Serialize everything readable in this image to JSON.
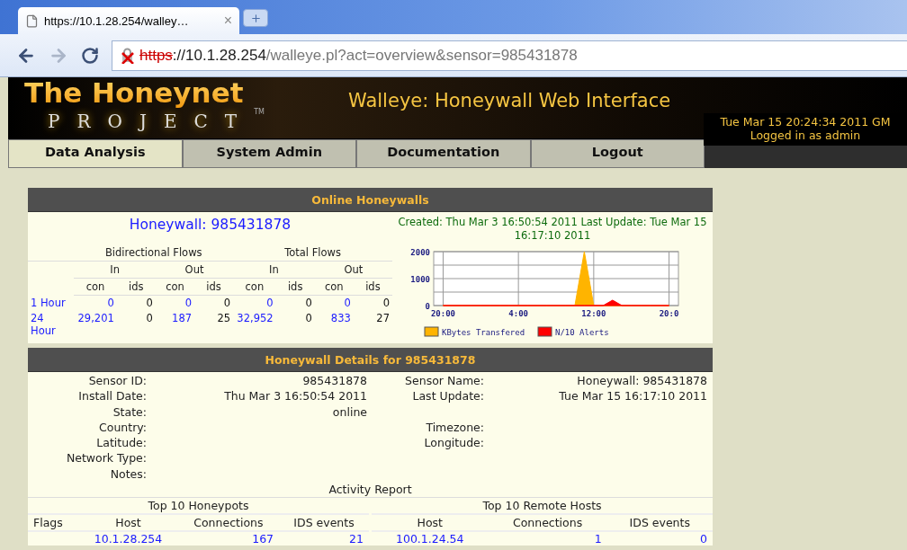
{
  "browser": {
    "tab": {
      "title": "https://10.1.28.254/walley…",
      "close": "×"
    },
    "address": {
      "scheme": "https",
      "host": "://10.1.28.254",
      "path": "/walleye.pl?act=overview&sensor=985431878"
    }
  },
  "header": {
    "logo_top": "The Honeynet",
    "logo_bottom": "PROJECT",
    "trademark": "TM",
    "title": "Walleye: Honeywall Web Interface",
    "datetime": "Tue Mar 15 20:24:34 2011 GM",
    "login": "Logged in as admin"
  },
  "nav": [
    {
      "label": "Data Analysis",
      "selected": true
    },
    {
      "label": "System Admin",
      "selected": false
    },
    {
      "label": "Documentation",
      "selected": false
    },
    {
      "label": "Logout",
      "selected": false
    }
  ],
  "online": {
    "title": "Online Honeywalls",
    "honeywall": "Honeywall: 985431878",
    "created": "Created: Thu Mar 3 16:50:54 2011 Last Update: Tue Mar 15 16:17:10 2011",
    "flows": {
      "groups": [
        "Bidirectional Flows",
        "Total Flows"
      ],
      "directions": [
        "In",
        "Out",
        "In",
        "Out"
      ],
      "columns": [
        "con",
        "ids",
        "con",
        "ids",
        "con",
        "ids",
        "con",
        "ids"
      ],
      "rows": [
        {
          "period": "1 Hour",
          "cells": [
            {
              "text": "0",
              "kind": "link"
            },
            {
              "text": "0",
              "kind": "plain"
            },
            {
              "text": "0",
              "kind": "link"
            },
            {
              "text": "0",
              "kind": "plain"
            },
            {
              "text": "0",
              "kind": "link"
            },
            {
              "text": "0",
              "kind": "plain"
            },
            {
              "text": "0",
              "kind": "link"
            },
            {
              "text": "0",
              "kind": "plain"
            }
          ]
        },
        {
          "period": "24 Hour",
          "cells": [
            {
              "text": "29,201",
              "kind": "link"
            },
            {
              "text": "0",
              "kind": "plain"
            },
            {
              "text": "187",
              "kind": "link"
            },
            {
              "text": "25",
              "kind": "plain"
            },
            {
              "text": "32,952",
              "kind": "link"
            },
            {
              "text": "0",
              "kind": "plain"
            },
            {
              "text": "833",
              "kind": "link"
            },
            {
              "text": "27",
              "kind": "plain"
            }
          ]
        }
      ]
    },
    "chart_data": {
      "type": "area",
      "categories": [
        "20:00",
        null,
        null,
        null,
        null,
        null,
        null,
        null,
        "4:00",
        null,
        null,
        null,
        null,
        null,
        null,
        null,
        "12:00",
        null,
        null,
        null,
        null,
        null,
        null,
        null,
        "20:0"
      ],
      "ylim": [
        0,
        2000
      ],
      "yticks": [
        0,
        1000,
        2000
      ],
      "grid": true,
      "legend": "bottom",
      "series": [
        {
          "name": "KBytes Transfered",
          "color": "#ffb400",
          "values": [
            0,
            0,
            0,
            0,
            0,
            0,
            0,
            0,
            0,
            0,
            0,
            0,
            0,
            0,
            0,
            2000,
            0,
            0,
            0,
            0,
            0,
            0,
            0,
            0,
            0
          ]
        },
        {
          "name": "N/10 Alerts",
          "color": "#ff0000",
          "values": [
            0,
            0,
            0,
            0,
            0,
            0,
            0,
            0,
            0,
            0,
            0,
            0,
            0,
            0,
            0,
            0,
            0,
            0,
            200,
            0,
            0,
            0,
            0,
            0,
            0
          ]
        }
      ]
    }
  },
  "details": {
    "title": "Honeywall Details for 985431878",
    "rows": [
      {
        "label": "Sensor ID:",
        "value": "985431878",
        "label_2": "Sensor Name:",
        "value_2": "Honeywall: 985431878"
      },
      {
        "label": "Install Date:",
        "value": "Thu Mar 3 16:50:54 2011",
        "label_2": "Last Update:",
        "value_2": "Tue Mar 15 16:17:10 2011"
      },
      {
        "label": "State:",
        "value": "online"
      },
      {
        "label": "Country:",
        "label_2": "Timezone:"
      },
      {
        "label": "Latitude:",
        "label_2": "Longitude:"
      },
      {
        "label": "Network Type:"
      },
      {
        "label": "Notes:"
      }
    ],
    "activity_title": "Activity Report",
    "honeypots": {
      "title": "Top 10 Honeypots",
      "columns": [
        "Flags",
        "Host",
        "Connections",
        "IDS events"
      ],
      "rows": [
        {
          "host": "10.1.28.254",
          "connections": "167",
          "ids_events": "21"
        }
      ]
    },
    "remote_hosts": {
      "title": "Top 10 Remote Hosts",
      "columns": [
        "Host",
        "Connections",
        "IDS events"
      ],
      "rows": [
        {
          "host": "100.1.24.54",
          "connections": "1",
          "ids_events": "0"
        }
      ]
    }
  }
}
